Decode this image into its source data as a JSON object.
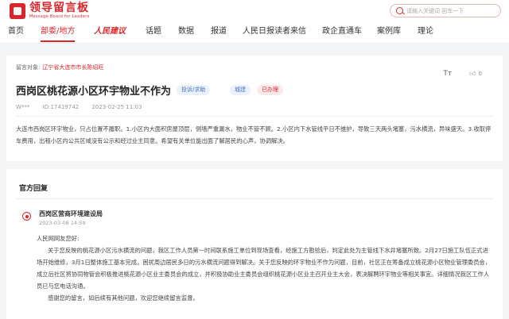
{
  "header": {
    "logo_title": "领导留言板",
    "logo_subtitle": "Message Board for Leaders",
    "search_placeholder": "请输入关键词 回车一下"
  },
  "nav": {
    "items": [
      "首页",
      "部委/地方",
      "人民建议",
      "话题",
      "数据",
      "报道",
      "人民日报读者来信",
      "政企直通车",
      "案例库",
      "理论"
    ]
  },
  "message": {
    "target_label": "留言对象:",
    "target_value": "辽宁省大连市市长陈绍旺",
    "title": "西岗区桃花源小区环宇物业不作为",
    "tags": {
      "type": "投诉/求助",
      "field": "城建",
      "status": "已办理"
    },
    "author": "W***",
    "id": "ID:17419742",
    "time": "2023-02-25 11:03",
    "like_count": "0",
    "content": "大连市西岗区环宇物业，只占位置不履职。1.小区内大面积房屋顶层，侧墙严重漏水，物业不管不顾。2.小区内下水管线平日不维护，导致三天两头堵塞，污水横流，异味盛天。3.收取停车费用，出租小区内公共区域没有公示和经过业主同意。希望有关单位能出面了解居民的心声，协调解决。"
  },
  "reply": {
    "section_title": "官方回复",
    "department": "西岗区营商环境建设局",
    "time": "2023-03-08 14:59",
    "greeting": "人民网网友您好:",
    "body": "关于您反映的桃花源小区污水横流的问题，我区工作人员第一时间联系施工单位到现场查看，经施工方勘验后，判定此处为主管线下水井堵塞所致。2月27日施工队伍正式进场开始维修，3月1日整体施工基本完成，困扰周边居民多日的污水横流问题得到解决。关于您反映的环宇物业不作为问题，目前，社区正在筹备成立桃花源小区物业管理委员会，成立后社区将协同物管会积极推进桃花源小区业主委员会的成立，并积极协助业主委员会组织桃花源小区业主召开业主大会，表决解聘环宇物业等相关事宜。详细情况我区工作人员已与您电话沟通。",
    "closing": "感谢您的留言，如后续有其他问题，欢迎您继续留言监督。"
  },
  "colors": {
    "accent": "#d9262c",
    "tag_blue": "#4a76b8"
  }
}
